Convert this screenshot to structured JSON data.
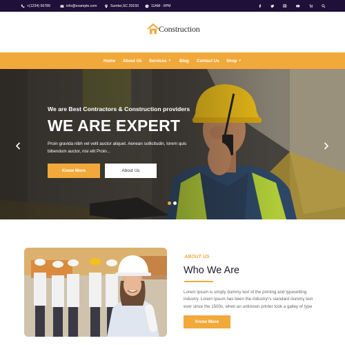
{
  "topbar": {
    "phone": "+(1234) 56789",
    "email": "info@example.com",
    "location": "Sumter,SC 29150",
    "hours": "11AM - 6PM",
    "icons": [
      "facebook-icon",
      "twitter-icon",
      "instagram-icon",
      "youtube-icon",
      "cart-icon",
      "search-icon"
    ]
  },
  "header": {
    "logo_text": "Construction"
  },
  "nav": {
    "items": [
      {
        "label": "Home"
      },
      {
        "label": "About Us"
      },
      {
        "label": "Services"
      },
      {
        "label": "Blog"
      },
      {
        "label": "Contact Us"
      },
      {
        "label": "Shop"
      }
    ]
  },
  "hero": {
    "subtitle": "We are Best Contractors & Construction providers",
    "title": "WE ARE EXPERT",
    "description": "Proin gravida nibh vel velit auctor aliquet. Aenean sollicitudin, lorem quis bibendum auctor, nisi elit Proin...",
    "primary_button": "Know More",
    "secondary_button": "About Us"
  },
  "about": {
    "eyebrow": "ABOUT US",
    "title": "Who We Are",
    "text": "Lorem Ipsum is simply dummy text of the printing and typesetting industry. Lorem Ipsum has been the industry\\'s standard dummy text ever since the 1500s, when an unknown printer took a galley of type",
    "button": "Know More"
  },
  "colors": {
    "accent": "#f2a93b",
    "topbar": "#1e1038",
    "heading": "#1e1a2e"
  }
}
